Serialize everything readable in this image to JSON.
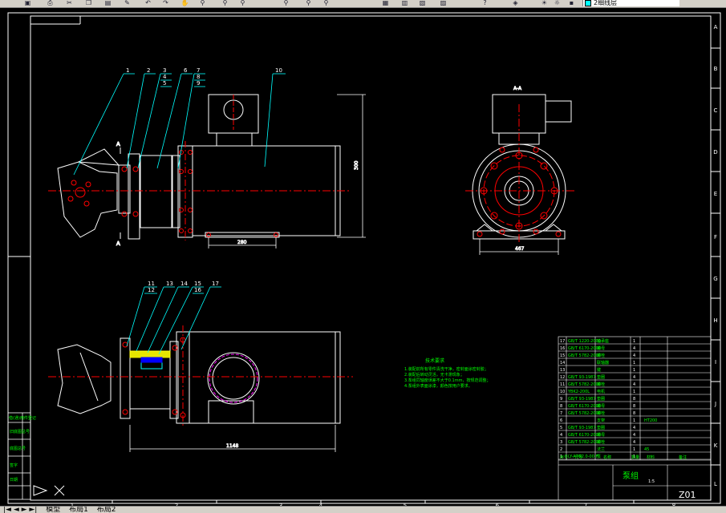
{
  "toolbar": {
    "icons": [
      "save-icon",
      "print-icon",
      "cut-icon",
      "copy-icon",
      "paste-icon",
      "match-icon",
      "undo-icon",
      "redo-icon",
      "pan-icon",
      "zoom-realtime-icon",
      "zoom-window-icon",
      "zoom-previous-icon",
      "properties-icon",
      "design-center-icon",
      "tool-palette-icon",
      "help-icon",
      "layer-icon",
      "light-bulb-icon",
      "sun-icon",
      "lock-icon"
    ],
    "layer_name": "2细线层"
  },
  "drawing": {
    "balloons_top": [
      "1",
      "2",
      "3",
      "4",
      "5",
      "6",
      "7",
      "8",
      "9",
      "10"
    ],
    "balloons_bottom": [
      "11",
      "12",
      "13",
      "14",
      "15",
      "16",
      "17"
    ],
    "section_marks": [
      "A",
      "A",
      "A-A"
    ],
    "dimensions": {
      "top_length": "280",
      "height": "300",
      "front_width": "467",
      "bottom_length": "1148"
    },
    "notes_title": "技术要求",
    "notes": [
      "1.装配前所有零件清洗干净，密封面涂密封胶；",
      "2.装配后转动灵活，无卡滞现象；",
      "3.泵组同轴度误差不大于0.1mm，按规范调整；",
      "4.泵组外表面涂漆，颜色按用户要求。"
    ],
    "frame_letters": [
      "A",
      "B",
      "C",
      "D",
      "E",
      "F",
      "G",
      "H",
      "I",
      "J",
      "K",
      "L"
    ],
    "frame_numbers": [
      "1",
      "2",
      "3",
      "4",
      "5",
      "6",
      "7",
      "8"
    ]
  },
  "title_block": {
    "rows": [
      {
        "no": "17",
        "code": "GB/T 1220-2000",
        "name": "轴承座",
        "qty": "1",
        "mat": "",
        "note": ""
      },
      {
        "no": "16",
        "code": "GB/T 6170-2000",
        "name": "螺母",
        "qty": "4",
        "mat": "",
        "note": ""
      },
      {
        "no": "15",
        "code": "GB/T 5782-2000",
        "name": "螺栓",
        "qty": "4",
        "mat": "",
        "note": ""
      },
      {
        "no": "14",
        "code": "",
        "name": "联轴器",
        "qty": "1",
        "mat": "",
        "note": ""
      },
      {
        "no": "13",
        "code": "",
        "name": "键",
        "qty": "1",
        "mat": "",
        "note": ""
      },
      {
        "no": "12",
        "code": "GB/T 93-1987",
        "name": "垫圈",
        "qty": "4",
        "mat": "",
        "note": ""
      },
      {
        "no": "11",
        "code": "GB/T 5782-2000",
        "name": "螺栓",
        "qty": "4",
        "mat": "",
        "note": ""
      },
      {
        "no": "10",
        "code": "YBK2-200L",
        "name": "电机",
        "qty": "1",
        "mat": "",
        "note": ""
      },
      {
        "no": "9",
        "code": "GB/T 93-1987",
        "name": "垫圈",
        "qty": "8",
        "mat": "",
        "note": ""
      },
      {
        "no": "8",
        "code": "GB/T 6170-2000",
        "name": "螺母",
        "qty": "8",
        "mat": "",
        "note": ""
      },
      {
        "no": "7",
        "code": "GB/T 5782-2000",
        "name": "螺栓",
        "qty": "8",
        "mat": "",
        "note": ""
      },
      {
        "no": "6",
        "code": "",
        "name": "支架",
        "qty": "1",
        "mat": "HT200",
        "note": ""
      },
      {
        "no": "5",
        "code": "GB/T 93-1987",
        "name": "垫圈",
        "qty": "4",
        "mat": "",
        "note": ""
      },
      {
        "no": "4",
        "code": "GB/T 6170-2000",
        "name": "螺母",
        "qty": "4",
        "mat": "",
        "note": ""
      },
      {
        "no": "3",
        "code": "GB/T 5782-2000",
        "name": "螺栓",
        "qty": "4",
        "mat": "",
        "note": ""
      },
      {
        "no": "2",
        "code": "",
        "name": "法兰",
        "qty": "1",
        "mat": "45",
        "note": ""
      },
      {
        "no": "1",
        "code": "LY-A7G2.0-00-F",
        "name": "泵",
        "qty": "1",
        "mat": "",
        "note": ""
      }
    ],
    "headers": [
      "序号",
      "代号",
      "名称",
      "数量",
      "材料",
      "备注"
    ],
    "assembly_name": "泵组",
    "drawing_no": "Z01",
    "scale": "1:5"
  },
  "side_table": [
    "借(通)用件登记",
    "旧底图总号",
    "底图总号",
    "签字",
    "日期"
  ],
  "tabs": [
    "模型",
    "布局1",
    "布局2"
  ]
}
